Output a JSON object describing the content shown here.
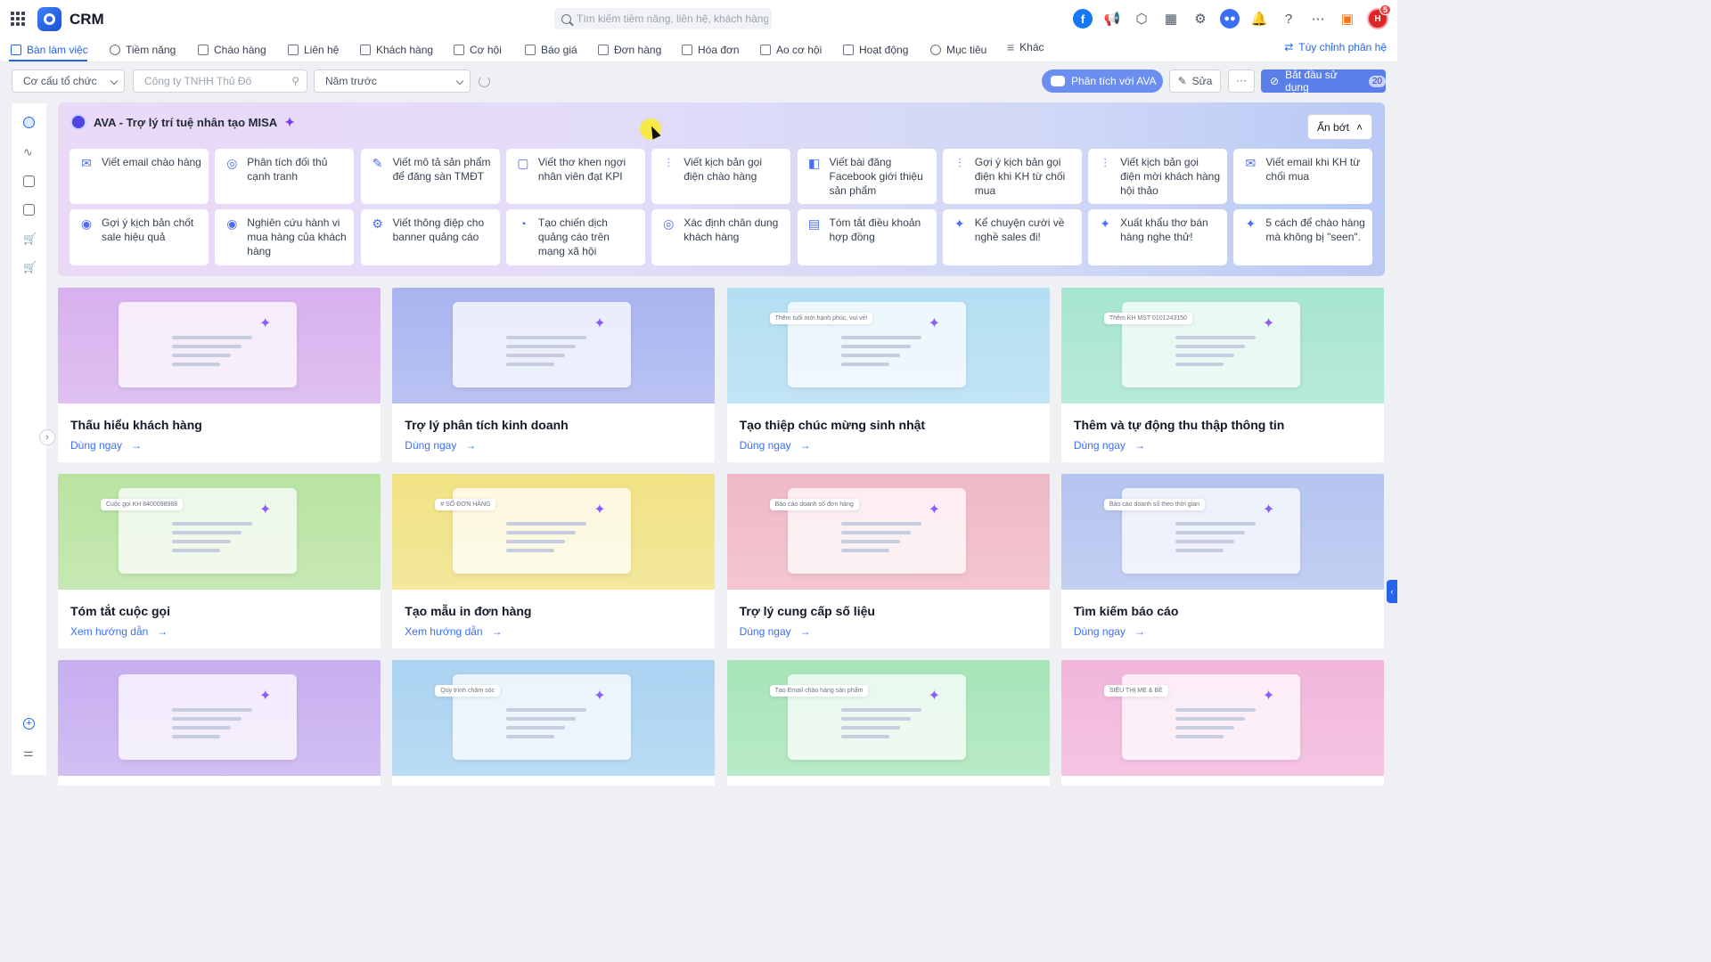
{
  "app": {
    "title": "CRM"
  },
  "search": {
    "placeholder": "Tìm kiếm tiềm năng, liên hệ, khách hàng"
  },
  "user": {
    "initials": "H",
    "notification_count": "5"
  },
  "nav": {
    "items": [
      {
        "label": "Bàn làm việc",
        "icon": "home-icon",
        "active": true
      },
      {
        "label": "Tiềm năng",
        "icon": "target-icon"
      },
      {
        "label": "Chào hàng",
        "icon": "hand-icon"
      },
      {
        "label": "Liên hệ",
        "icon": "contact-icon"
      },
      {
        "label": "Khách hàng",
        "icon": "building-icon"
      },
      {
        "label": "Cơ hội",
        "icon": "briefcase-icon"
      },
      {
        "label": "Báo giá",
        "icon": "document-icon"
      },
      {
        "label": "Đơn hàng",
        "icon": "cart-icon"
      },
      {
        "label": "Hóa đơn",
        "icon": "invoice-icon"
      },
      {
        "label": "Ao cơ hội",
        "icon": "funnel-icon"
      },
      {
        "label": "Hoạt động",
        "icon": "activity-icon"
      },
      {
        "label": "Mục tiêu",
        "icon": "goal-icon"
      },
      {
        "label": "Khác",
        "icon": "menu-icon"
      }
    ],
    "customize_label": "Tùy chỉnh phân hệ"
  },
  "filters": {
    "org": "Cơ cấu tổ chức",
    "company": "Công ty TNHH Thủ Đô",
    "period": "Năm trước"
  },
  "actions": {
    "ava_label": "Phân tích với AVA",
    "edit_label": "Sửa",
    "more_label": "···",
    "start_label": "Bắt đầu sử dụng",
    "start_count": "20"
  },
  "ava": {
    "title": "AVA - Trợ lý trí tuệ nhân tạo MISA",
    "hide_label": "Ẩn bớt",
    "prompts": [
      "Viết email chào hàng",
      "Phân tích đối thủ cạnh tranh",
      "Viết mô tả sản phẩm để đăng sàn TMĐT",
      "Viết thơ khen ngợi nhân viên đạt KPI",
      "Viết kịch bản gọi điện chào hàng",
      "Viết bài đăng Facebook giới thiệu sản phẩm",
      "Gợi ý kịch bản gọi điện khi KH từ chối mua",
      "Viết kịch bản gọi điện mời khách hàng hội thảo",
      "Viết email khi KH từ chối mua",
      "Gợi ý kịch bản chốt sale hiệu quả",
      "Nghiên cứu hành vi mua hàng của khách hàng",
      "Viết thông điệp cho banner quảng cáo",
      "Tạo chiến dịch quảng cáo trên mạng xã hội",
      "Xác định chân dung khách hàng",
      "Tóm tắt điều khoản hợp đồng",
      "Kể chuyện cười về nghề sales đi!",
      "Xuất khẩu thơ bán hàng nghe thử!",
      "5 cách để chào hàng mà không bị \"seen\"."
    ]
  },
  "cards": [
    {
      "title": "Thấu hiểu khách hàng",
      "link": "Dùng ngay",
      "color": "#d7b1ee"
    },
    {
      "title": "Trợ lý phân tích kinh doanh",
      "link": "Dùng ngay",
      "color": "#a9b4f0"
    },
    {
      "title": "Tạo thiệp chúc mừng sinh nhật",
      "link": "Dùng ngay",
      "color": "#b3def2",
      "chip": "Thêm tuổi mới hạnh phúc, vui vẻ!"
    },
    {
      "title": "Thêm và tự động thu thập thông tin",
      "link": "Dùng ngay",
      "color": "#a6e5cf",
      "chip": "Thêm KH MST 0101243150"
    },
    {
      "title": "Tóm tắt cuộc gọi",
      "link": "Xem hướng dẫn",
      "color": "#b9e3a1",
      "chip": "Cuộc gọi KH 8400098988"
    },
    {
      "title": "Tạo mẫu in đơn hàng",
      "link": "Xem hướng dẫn",
      "color": "#f0e283",
      "chip": "# SỐ ĐƠN HÀNG"
    },
    {
      "title": "Trợ lý cung cấp số liệu",
      "link": "Dùng ngay",
      "color": "#f0b8c6",
      "chip": "Báo cáo doanh số đơn hàng"
    },
    {
      "title": "Tìm kiếm báo cáo",
      "link": "Dùng ngay",
      "color": "#b4c4f0",
      "chip": "Báo cáo doanh số theo thời gian"
    },
    {
      "title": "",
      "link": "",
      "color": "#c7aef0"
    },
    {
      "title": "",
      "link": "",
      "color": "#aad3f1",
      "chip": "Quy trình chăm sóc"
    },
    {
      "title": "",
      "link": "",
      "color": "#a6e5b8",
      "chip": "Tạo Email chào hàng sản phẩm"
    },
    {
      "title": "",
      "link": "",
      "color": "#f2b6db",
      "chip": "SIÊU THỊ MẸ & BÉ"
    }
  ]
}
